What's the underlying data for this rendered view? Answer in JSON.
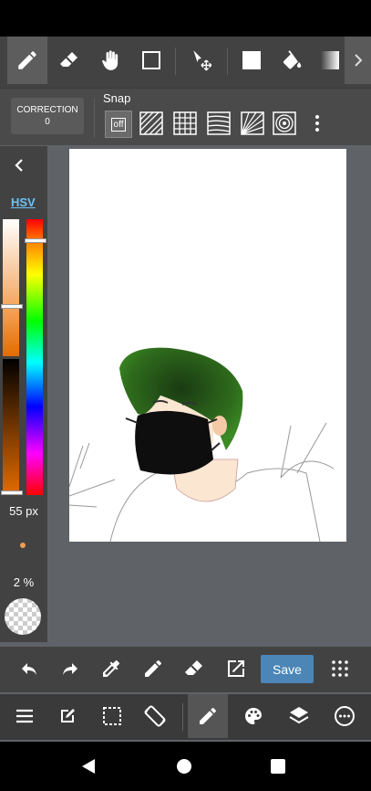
{
  "toolbar": {
    "tools": [
      "pen-icon",
      "eraser-icon",
      "hand-icon",
      "rectangle-select-icon",
      "move-icon",
      "fill-color-icon",
      "bucket-icon",
      "gradient-icon",
      "chevron-right-icon"
    ]
  },
  "snap": {
    "correction_label": "CORRECTION",
    "correction_value": "0",
    "snap_label": "Snap",
    "off_label": "off"
  },
  "left_panel": {
    "hsv_label": "HSV",
    "brush_size": "55 px",
    "opacity": "2 %",
    "primary_color": "#f7a86a",
    "secondary_color": "#e36b00"
  },
  "bottom_toolbar": {
    "save_label": "Save"
  },
  "colors": {
    "accent": "#4b86b7",
    "hsv_link": "#6ec3f5"
  }
}
